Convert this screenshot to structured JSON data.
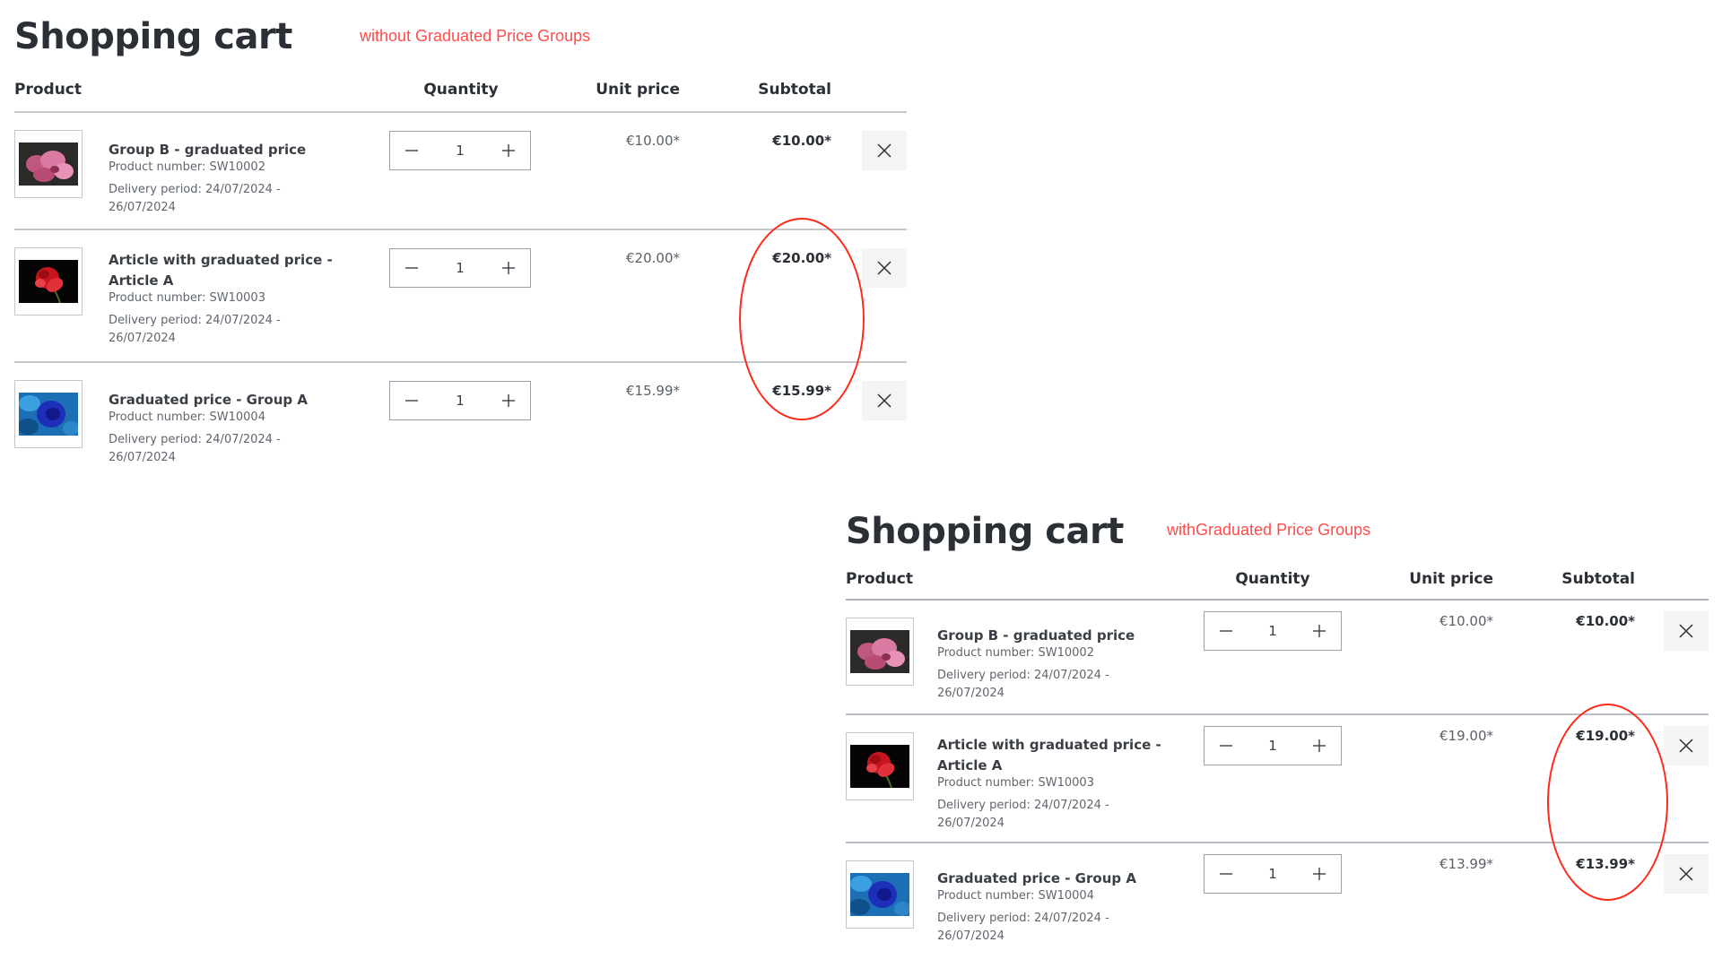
{
  "carts": [
    {
      "id": "without",
      "title": "Shopping cart",
      "annotation": "without Graduated Price Groups",
      "headers": {
        "product": "Product",
        "quantity": "Quantity",
        "unit_price": "Unit price",
        "subtotal": "Subtotal"
      },
      "items": [
        {
          "name": "Group B - graduated price",
          "product_number": "Product number: SW10002",
          "delivery": "Delivery period: 24/07/2024 - 26/07/2024",
          "image": "pink-orchid",
          "quantity": "1",
          "unit_price": "€10.00*",
          "subtotal": "€10.00*"
        },
        {
          "name": "Article with graduated price - Article A",
          "product_number": "Product number: SW10003",
          "delivery": "Delivery period: 24/07/2024 - 26/07/2024",
          "image": "red-rose",
          "quantity": "1",
          "unit_price": "€20.00*",
          "subtotal": "€20.00*"
        },
        {
          "name": "Graduated price - Group A",
          "product_number": "Product number: SW10004",
          "delivery": "Delivery period: 24/07/2024 - 26/07/2024",
          "image": "blue-rose",
          "quantity": "1",
          "unit_price": "€15.99*",
          "subtotal": "€15.99*"
        }
      ]
    },
    {
      "id": "with",
      "title": "Shopping cart",
      "annotation": "withGraduated Price Groups",
      "headers": {
        "product": "Product",
        "quantity": "Quantity",
        "unit_price": "Unit price",
        "subtotal": "Subtotal"
      },
      "items": [
        {
          "name": "Group B - graduated price",
          "product_number": "Product number: SW10002",
          "delivery": "Delivery period: 24/07/2024 - 26/07/2024",
          "image": "pink-orchid",
          "quantity": "1",
          "unit_price": "€10.00*",
          "subtotal": "€10.00*"
        },
        {
          "name": "Article with graduated price - Article A",
          "product_number": "Product number: SW10003",
          "delivery": "Delivery period: 24/07/2024 - 26/07/2024",
          "image": "red-rose",
          "quantity": "1",
          "unit_price": "€19.00*",
          "subtotal": "€19.00*"
        },
        {
          "name": "Graduated price - Group A",
          "product_number": "Product number: SW10004",
          "delivery": "Delivery period: 24/07/2024 - 26/07/2024",
          "image": "blue-rose",
          "quantity": "1",
          "unit_price": "€13.99*",
          "subtotal": "€13.99*"
        }
      ]
    }
  ],
  "icons": {
    "decrease": "minus-icon",
    "increase": "plus-icon",
    "remove": "close-icon"
  },
  "colors": {
    "annotation": "#ff4b4b",
    "highlight_ellipse": "#ff2a1a",
    "text": "#2b2f36"
  }
}
